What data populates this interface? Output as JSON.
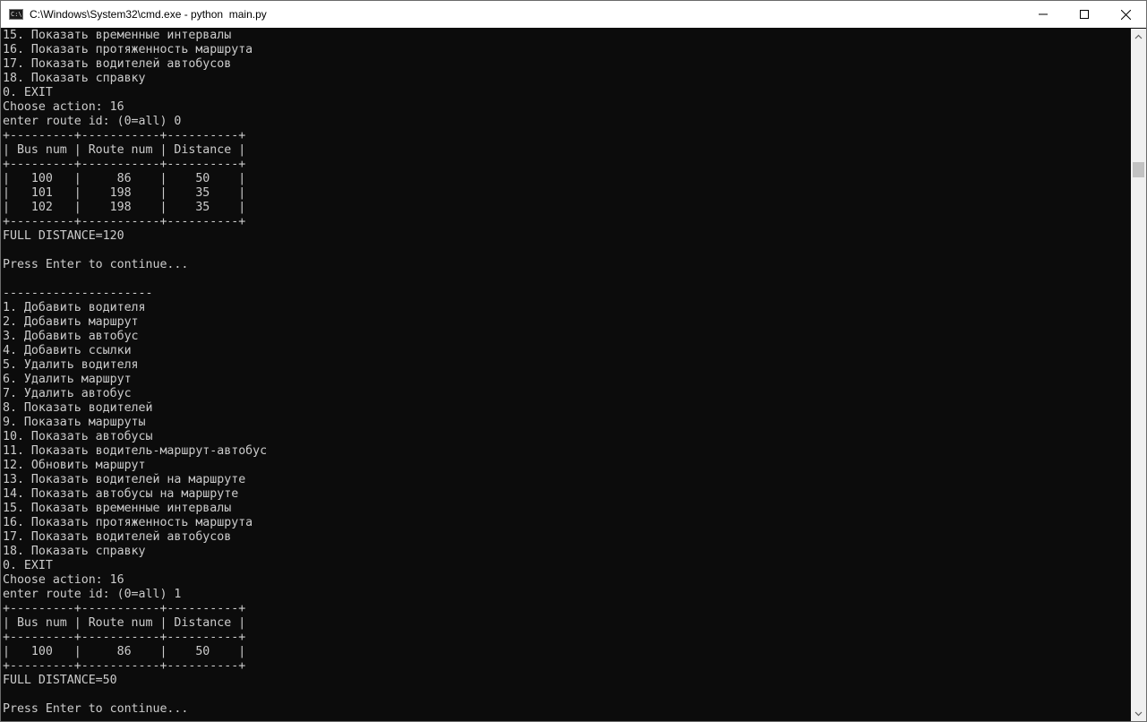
{
  "window": {
    "title": "C:\\Windows\\System32\\cmd.exe - python  main.py",
    "icon": "cmd-console-icon",
    "controls": {
      "minimize_icon": "minimize-icon",
      "maximize_icon": "maximize-icon",
      "close_icon": "close-icon"
    }
  },
  "terminal": {
    "background": "#0c0c0c",
    "foreground": "#cccccc",
    "lines": [
      "15. Показать временные интервалы",
      "16. Показать протяженность маршрута",
      "17. Показать водителей автобусов",
      "18. Показать справку",
      "0. EXIT",
      "Choose action: 16",
      "enter route id: (0=all) 0",
      "+---------+-----------+----------+",
      "| Bus num | Route num | Distance |",
      "+---------+-----------+----------+",
      "|   100   |     86    |    50    |",
      "|   101   |    198    |    35    |",
      "|   102   |    198    |    35    |",
      "+---------+-----------+----------+",
      "FULL DISTANCE=120",
      "",
      "Press Enter to continue...",
      "",
      "---------------------",
      "1. Добавить водителя",
      "2. Добавить маршрут",
      "3. Добавить автобус",
      "4. Добавить ссылки",
      "5. Удалить водителя",
      "6. Удалить маршрут",
      "7. Удалить автобус",
      "8. Показать водителей",
      "9. Показать маршруты",
      "10. Показать автобусы",
      "11. Показать водитель-маршрут-автобус",
      "12. Обновить маршрут",
      "13. Показать водителей на маршруте",
      "14. Показать автобусы на маршруте",
      "15. Показать временные интервалы",
      "16. Показать протяженность маршрута",
      "17. Показать водителей автобусов",
      "18. Показать справку",
      "0. EXIT",
      "Choose action: 16",
      "enter route id: (0=all) 1",
      "+---------+-----------+----------+",
      "| Bus num | Route num | Distance |",
      "+---------+-----------+----------+",
      "|   100   |     86    |    50    |",
      "+---------+-----------+----------+",
      "FULL DISTANCE=50",
      "",
      "Press Enter to continue..."
    ]
  },
  "scrollbar": {
    "up_icon": "scroll-up-arrow-icon",
    "down_icon": "scroll-down-arrow-icon"
  }
}
